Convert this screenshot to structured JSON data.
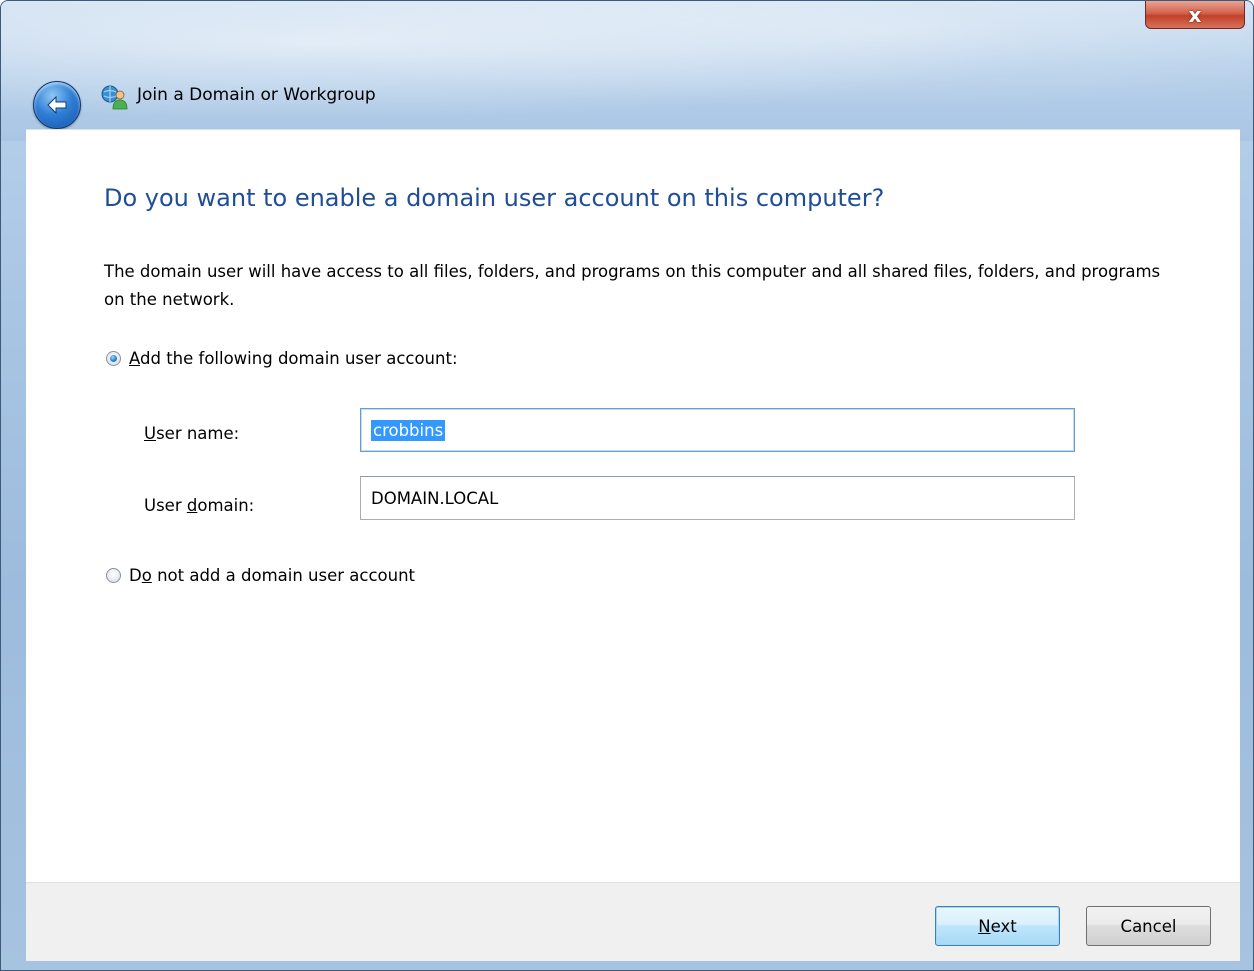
{
  "window": {
    "title": "Join a Domain or Workgroup",
    "close_glyph": "x"
  },
  "icons": {
    "back": "back-arrow-icon",
    "app": "network-users-icon",
    "close": "close-icon"
  },
  "content": {
    "heading": "Do you want to enable a domain user account on this computer?",
    "description": "The domain user will have access to all files, folders, and programs on this computer and all shared files, folders, and programs on the network.",
    "option_add": {
      "label_accel": "A",
      "label_rest": "dd the following domain user account:",
      "selected": true
    },
    "user_name": {
      "label_accel": "U",
      "label_rest": "ser name:",
      "value": "crobbins"
    },
    "user_domain": {
      "label_prefix": "User ",
      "label_accel": "d",
      "label_rest": "omain:",
      "value": "DOMAIN.LOCAL"
    },
    "option_none": {
      "label_prefix": "D",
      "label_accel": "o",
      "label_rest": " not add a domain user account",
      "selected": false
    }
  },
  "footer": {
    "next": {
      "accel": "N",
      "rest": "ext"
    },
    "cancel": "Cancel"
  },
  "colors": {
    "heading": "#1f4e96",
    "selection": "#3399ff",
    "close_button": "#c2402a"
  }
}
